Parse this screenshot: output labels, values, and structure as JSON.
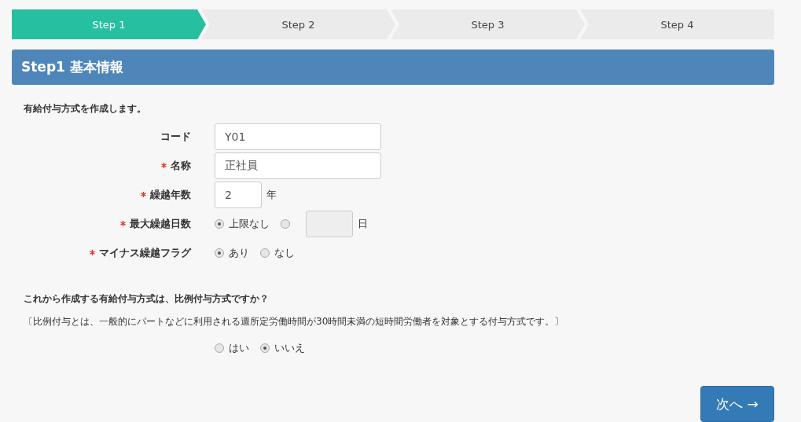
{
  "steps": [
    {
      "label": "Step 1",
      "selected": true
    },
    {
      "label": "Step 2",
      "selected": false
    },
    {
      "label": "Step 3",
      "selected": false
    },
    {
      "label": "Step 4",
      "selected": false
    }
  ],
  "section_title": "Step1 基本情報",
  "intro": "有給付与方式を作成します。",
  "fields": [
    {
      "kind": "text",
      "label": "コード",
      "required": false,
      "value": "Y01"
    },
    {
      "kind": "text",
      "label": "名称",
      "required": true,
      "value": "正社員"
    },
    {
      "kind": "number",
      "label": "繰越年数",
      "required": true,
      "value": "2",
      "unit": "年"
    },
    {
      "kind": "radio-input",
      "label": "最大繰越日数",
      "required": true,
      "options": [
        {
          "label": "上限なし",
          "selected": true
        },
        {
          "selected": false
        }
      ],
      "input_disabled": true,
      "unit": "日"
    },
    {
      "kind": "radio",
      "label": "マイナス繰越フラグ",
      "required": true,
      "options": [
        {
          "label": "あり",
          "selected": true
        },
        {
          "label": "なし",
          "selected": false
        }
      ]
    }
  ],
  "question": {
    "title": "これから作成する有給付与方式は、比例付与方式ですか？",
    "note": "〔比例付与とは、一般的にパートなどに利用される週所定労働時間が30時間未満の短時間労働者を対象とする付与方式です。〕",
    "options": [
      {
        "label": "はい",
        "selected": false
      },
      {
        "label": "いいえ",
        "selected": true
      }
    ]
  },
  "next_button": "次へ →"
}
